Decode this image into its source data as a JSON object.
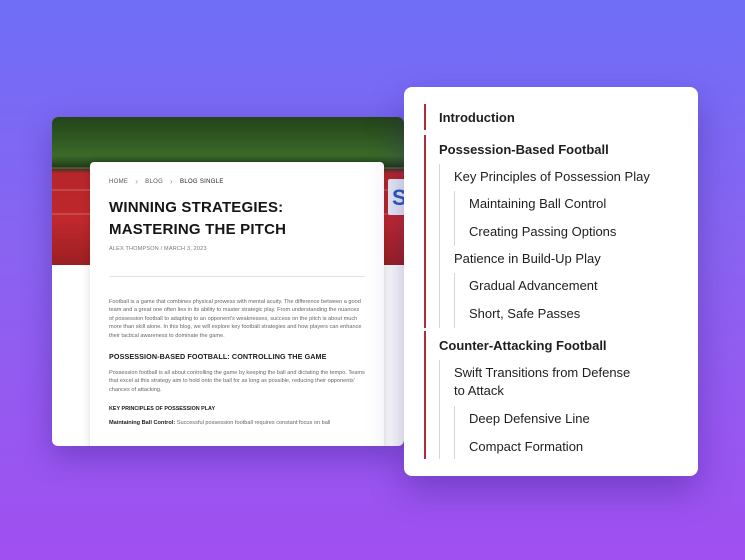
{
  "blog": {
    "breadcrumb": {
      "home": "HOME",
      "sep": "›",
      "blog": "BLOG",
      "current": "BLOG SINGLE"
    },
    "title": "WINNING STRATEGIES: MASTERING THE PITCH",
    "meta": "ALEX THOMPSON / MARCH 3, 2023",
    "intro": "Football is a game that combines physical prowess with mental acuity. The difference between a good team and a great one often lies in its ability to master strategic play. From understanding the nuances of possession football to adapting to an opponent's weaknesses, success on the pitch is about much more than skill alone. In this blog, we will explore key football strategies and how players can enhance their tactical awareness to dominate the game.",
    "section_heading": "POSSESSION-BASED FOOTBALL: CONTROLLING THE GAME",
    "section_text": "Possession football is all about controlling the game by keeping the ball and dictating the tempo. Teams that excel at this strategy aim to hold onto the ball for as long as possible, reducing their opponents' chances of attacking.",
    "subheading": "KEY PRINCIPLES OF POSSESSION PLAY",
    "sub_label": "Maintaining Ball Control:",
    "sub_text": " Successful possession football requires constant focus on ball"
  },
  "toc": {
    "items": [
      {
        "label": "Introduction",
        "level": 1
      },
      {
        "label": "Possession-Based Football",
        "level": 1
      },
      {
        "label": "Key Principles of Possession Play",
        "level": 2
      },
      {
        "label": "Maintaining Ball Control",
        "level": 3
      },
      {
        "label": "Creating Passing Options",
        "level": 3
      },
      {
        "label": "Patience in Build-Up Play",
        "level": 2
      },
      {
        "label": "Gradual Advancement",
        "level": 3
      },
      {
        "label": "Short, Safe Passes",
        "level": 3
      },
      {
        "label": "Counter-Attacking Football",
        "level": 1
      },
      {
        "label": "Swift Transitions from Defense to Attack",
        "level": 2
      },
      {
        "label": "Deep Defensive Line",
        "level": 3
      },
      {
        "label": "Compact Formation",
        "level": 3
      }
    ]
  },
  "colors": {
    "accent": "#b32a3a",
    "line_gray": "#d6d6d6"
  }
}
